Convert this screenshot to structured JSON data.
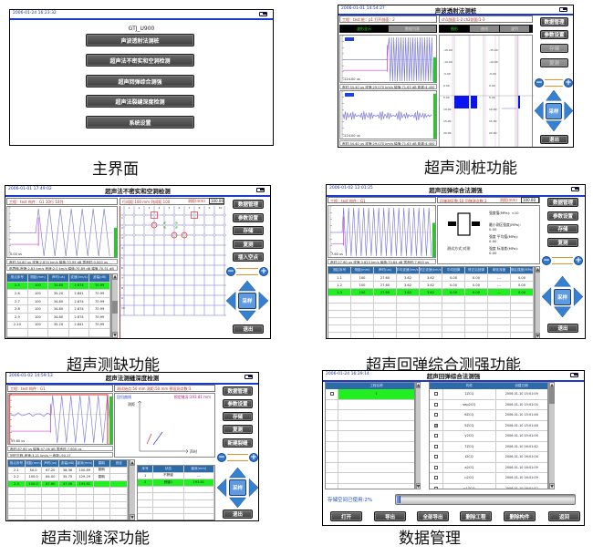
{
  "captions": {
    "main": "主界面",
    "pile": "超声测桩功能",
    "defect": "超声测缺功能",
    "strength": "超声回弹综合测强功能",
    "crack": "超声测缝深功能",
    "data": "数据管理"
  },
  "colors": {
    "accent": "#1a3ad0",
    "highlight": "#22ee22",
    "table_header": "#2d6aa8",
    "dpad": "#2f78d0",
    "waveform": "#7070d0"
  },
  "main": {
    "date": "2006-01-24 16:23:32",
    "model": "GTJ_U900",
    "buttons": [
      "声波透射法测桩",
      "超声法不密实和空洞检测",
      "超声回弹综合测强",
      "超声法裂缝深度检测",
      "系统设置"
    ]
  },
  "pile": {
    "date": "2006-01-01 14:54:27",
    "title": "声波透射法测桩",
    "info": "工程：test  桩：p1  打开剖面：2",
    "info2": "ch1剖面:1-2  ch2剖面:1-3",
    "tabs_left": [
      "波形显示",
      "数据列表"
    ],
    "tabs_right": [
      "图形",
      "曲线",
      "波列"
    ],
    "wave_label": "-224.00 us",
    "status1": "声时:34.40 us  波速:29.070 km/s  幅值:71.65 dB  距离:4.400 m",
    "status2": "声时:34.40 us  波速:29.070 km/s  幅值:71.65 dB  距离:4.400 m",
    "depth_ticks": [
      "-15.00",
      "-10.00",
      "-5.00",
      "0.00",
      "5.00",
      "10.00",
      "15.00",
      "20.00"
    ],
    "buttons": [
      "数据管理",
      "参数设置",
      "存储",
      "复测",
      "退出"
    ],
    "disabled_buttons": [
      2,
      3
    ],
    "sample": "采样"
  },
  "defect": {
    "date": "2006-01-01 17:49:02",
    "title": "超声法不密实和空洞检测",
    "info": "工程：test  构件：G1  10行  10列",
    "info2": "行间距:100 mm  列间距:100",
    "range_label": "测距(mm)",
    "range_value": "100.00",
    "wave_label": "0.00 us",
    "status1": "声时:34.80 us  波速:2.874 km/s  幅值:70.99 dB  零声时:0.000 us",
    "status2": "临界值-声速:2.83 km/s  声速:2.0 km/s  幅值:70.89 dB  幅值:70.51 dB",
    "headers": [
      "测点序号",
      "测距(mm)",
      "声时(us)",
      "波速(km/s)",
      "波幅(dB)"
    ],
    "rows": [
      [
        "2-5",
        "100",
        "34.80",
        "2.874",
        "70.99"
      ],
      [
        "2-6",
        "100",
        "35.20",
        "2.841",
        "70.99"
      ],
      [
        "2-7",
        "100",
        "34.80",
        "2.874",
        "70.99"
      ],
      [
        "2-8",
        "100",
        "34.80",
        "2.874",
        "70.99"
      ],
      [
        "2-9",
        "100",
        "34.80",
        "2.874",
        "70.99"
      ],
      [
        "2-10",
        "100",
        "35.20",
        "2.841",
        "70.99"
      ]
    ],
    "highlight_row": 0,
    "grid_cols": [
      "1",
      "2",
      "3",
      "4",
      "5",
      "6",
      "7",
      "8",
      "9",
      "10"
    ],
    "grid_rows": [
      "1",
      "2",
      "3",
      "4",
      "5",
      "6",
      "7",
      "8",
      "9",
      "10"
    ],
    "buttons": [
      "数据管理",
      "参数设置",
      "存储",
      "复测",
      "插入空点",
      "退出"
    ],
    "sample": "采样"
  },
  "strength": {
    "date": "2006-01-02 12:01:25",
    "title": "超声回弹综合法测强",
    "info": "工程：test  构件：G1",
    "info2": "回弹测区数:10  回弹测点数:3",
    "range_label": "测距(mm)",
    "range_value": "100.00",
    "wave_label": "7.60 us",
    "status1": "声时:27.60 us  波速:3.623 km/s  幅值:70.84 dB  零声时:7.600 us",
    "test_mode": "测试方式:对测",
    "results": [
      {
        "label": "强度值(MPa): <10",
        "value": ""
      },
      {
        "label": "最小测区强度(MPa):",
        "value": "0.00"
      },
      {
        "label": "强度  平均值(MPa):",
        "value": "0.00"
      },
      {
        "label": "强度  标准差(MPa):",
        "value": "0.00"
      }
    ],
    "headers": [
      "测区序号",
      "测距(mm)",
      "声时(us)",
      "平均波速(km/s)",
      "修正波速(km/s)",
      "平均回弹",
      "修正后回弹",
      "碳化深度",
      "测区强度(MPa)"
    ],
    "rows": [
      [
        "1-1",
        "100",
        "27.60",
        "3.62",
        "3.62",
        "0.00",
        "0.00",
        "---",
        "0.00"
      ],
      [
        "1-2",
        "100",
        "27.60",
        "3.62",
        "3.62",
        "0.00",
        "0.00",
        "---",
        "0.00"
      ],
      [
        "1-3",
        "100",
        "27.60",
        "3.62",
        "3.62",
        "0.00",
        "0.00",
        "---",
        "0.00"
      ]
    ],
    "highlight_row": 2,
    "buttons": [
      "数据管理",
      "参数设置",
      "存储",
      "复测",
      "退出"
    ],
    "sample": "采样"
  },
  "crack": {
    "date": "2006-01-02 14:59:13",
    "title": "超声法测缝深度检测",
    "info": "工程：test  构件：G1",
    "info2": "测试始点:50 mm  测距:50 mm  预设测点数:3",
    "wave_label": "55.60 us",
    "status1": "声时:87.60 us  幅值:47.06 dB  零声时:7.600 us",
    "status2": "回归方程-声速:3.21 km/s  一声距:-90.17",
    "curve_title": "回归曲线",
    "crack_depth": "预定缝深:193.81 mm",
    "y_axis": "测距",
    "x_axis": "声时",
    "headers": [
      "测点序号",
      "测距(mm)",
      "声时(us)",
      "波幅(dB)",
      "缝深(mm)",
      "翻转",
      "首波"
    ],
    "rows": [
      [
        "2-1",
        "50.0",
        "67.20",
        "38.38",
        "100.89",
        "翻转",
        ""
      ],
      [
        "2-2",
        "100.0",
        "84.00",
        "35.75",
        "129.29",
        "翻转",
        ""
      ],
      [
        "2-3",
        "150.0",
        "87.60",
        "47.06",
        "193.81",
        "",
        ""
      ]
    ],
    "highlight_row": 2,
    "side_headers": [
      "序号",
      "状态",
      "缝深(mm)"
    ],
    "side_rows": [
      [
        "1",
        "不跨缝",
        "---"
      ],
      [
        "2",
        "跨缝1",
        "193.81"
      ]
    ],
    "side_highlight_row": 1,
    "buttons": [
      "数据管理",
      "参数设置",
      "存储",
      "复测",
      "新建裂缝",
      "退出"
    ],
    "sample": "采样"
  },
  "data": {
    "date": "2006-01-24 16:29:14",
    "title": "超声回弹综合法测强",
    "project_header": "工程名称",
    "projects": [
      "1"
    ],
    "member_headers": [
      "构件",
      "创建日期"
    ],
    "members": [
      {
        "name": "1ZCQ",
        "date": "2006-01-10 15:01:09",
        "checked": false
      },
      {
        "name": "sep2CQ",
        "date": "2006-01-10 15:01:04",
        "checked": false
      },
      {
        "name": "6ZCQ",
        "date": "2006-01-10 15:01:46",
        "checked": false
      },
      {
        "name": "5ZCQ",
        "date": "2006-01-10 15:01:48",
        "checked": true
      },
      {
        "name": "y2CQ",
        "date": "2006-01-10 15:01:04",
        "checked": false
      },
      {
        "name": "7ZCQ",
        "date": "2006-01-10 16:01:42",
        "checked": false
      },
      {
        "name": "t2CQ",
        "date": "2006-01-10 16:01:04",
        "checked": false
      },
      {
        "name": "a2CQ",
        "date": "2006-01-10 16:01:09",
        "checked": false
      },
      {
        "name": "u2CQ",
        "date": "2006-01-10 16:01:09",
        "checked": false
      },
      {
        "name": "u1ZCQ",
        "date": "2006-01-10 16:01:52",
        "checked": false
      }
    ],
    "storage_label": "存储空间已使用:2%",
    "storage_used_percent": 2,
    "buttons": [
      "打开",
      "导出",
      "全部导出",
      "删除工程",
      "删除构件",
      "返回"
    ]
  }
}
